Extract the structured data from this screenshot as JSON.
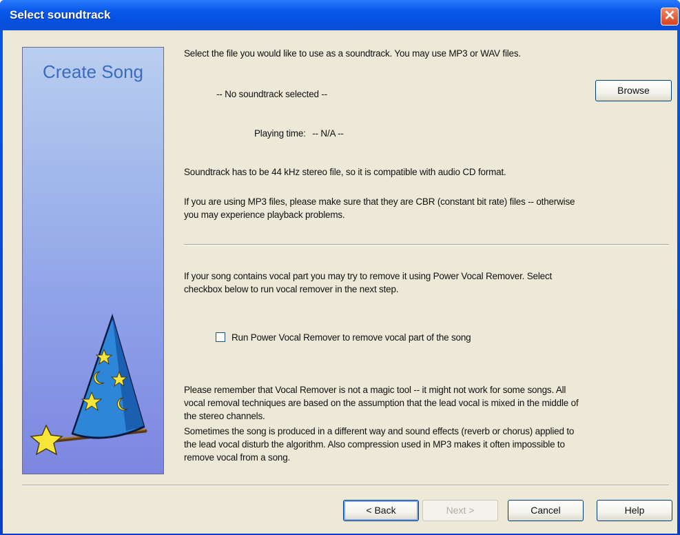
{
  "window": {
    "title": "Select soundtrack",
    "close_label": "✕"
  },
  "side_panel": {
    "title": "Create Song"
  },
  "content": {
    "intro": "Select the file you would like to use as a soundtrack. You may use MP3 or WAV files.",
    "file_status": "-- No soundtrack selected --",
    "browse_label": "Browse",
    "playing_time_label": "Playing time:",
    "playing_time_value": "-- N/A --",
    "format_note": "Soundtrack has to be 44 kHz stereo file, so it is compatible with audio CD format.",
    "cbr_note_line1": "If you are using MP3 files, please make sure that they are CBR (constant bit rate) files -- otherwise",
    "cbr_note_line2": "you may experience playback problems.",
    "vocal_intro_line1": "If your song contains vocal part you may try to remove it using Power Vocal Remover. Select",
    "vocal_intro_line2": "checkbox below to run vocal remover in the next step.",
    "checkbox_label": "Run Power Vocal Remover to remove vocal part of the song",
    "checkbox_checked": false,
    "warning_line1": "Please remember that Vocal Remover is not a magic tool -- it might not work for some songs. All",
    "warning_line2": "vocal removal techniques are based on the assumption that the lead vocal is mixed in the middle of",
    "warning_line3": "the stereo channels.",
    "warning_line4": "Sometimes the song is produced in a different way and sound effects (reverb or chorus) applied to",
    "warning_line5": "the lead vocal disturb the algorithm. Also compression used in MP3 makes it often impossible to",
    "warning_line6": "remove vocal from a song."
  },
  "buttons": {
    "back": "< Back",
    "next": "Next >",
    "cancel": "Cancel",
    "help": "Help"
  },
  "icons": {
    "close": "close-icon",
    "wizard": "wizard-hat-icon",
    "checkbox": "checkbox-icon"
  },
  "colors": {
    "titlebar": "#0a58ea",
    "dialog_bg": "#ece9d8",
    "panel_title": "#3b6bbd",
    "close_button": "#d8401c"
  }
}
